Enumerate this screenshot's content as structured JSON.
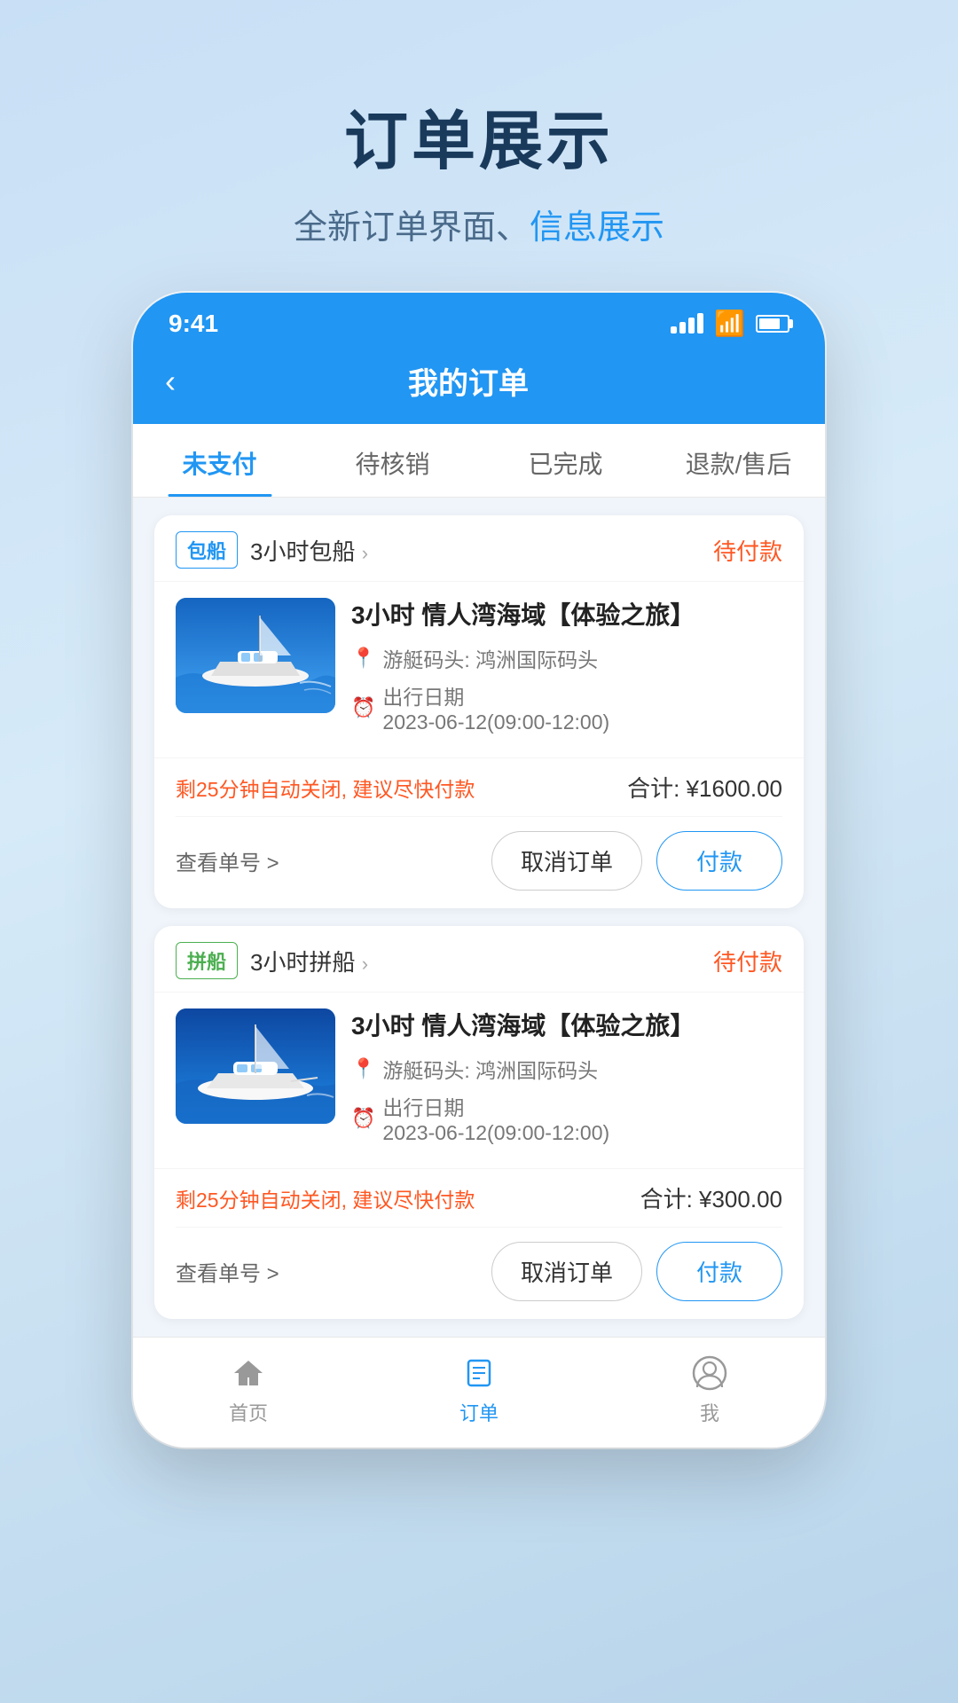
{
  "page": {
    "title": "订单展示",
    "subtitle_part1": "全新订单界面、",
    "subtitle_part2": "信息展示"
  },
  "statusBar": {
    "time": "9:41",
    "signal": "signal",
    "wifi": "wifi",
    "battery": "battery"
  },
  "navBar": {
    "title": "我的订单",
    "backLabel": "<"
  },
  "tabs": [
    {
      "label": "未支付",
      "active": true
    },
    {
      "label": "待核销",
      "active": false
    },
    {
      "label": "已完成",
      "active": false
    },
    {
      "label": "退款/售后",
      "active": false
    }
  ],
  "orders": [
    {
      "tag": "包船",
      "tagClass": "baochuan",
      "type": "3小时包船",
      "status": "待付款",
      "name": "3小时 情人湾海域【体验之旅】",
      "location": "游艇码头: 鸿洲国际码头",
      "dateLabel": "出行日期",
      "date": "2023-06-12(09:00-12:00)",
      "warning": "剩25分钟自动关闭, 建议尽快付款",
      "total": "合计: ¥1600.00",
      "viewOrder": "查看单号 >",
      "btnCancel": "取消订单",
      "btnPay": "付款"
    },
    {
      "tag": "拼船",
      "tagClass": "pinjian",
      "type": "3小时拼船",
      "status": "待付款",
      "name": "3小时 情人湾海域【体验之旅】",
      "location": "游艇码头: 鸿洲国际码头",
      "dateLabel": "出行日期",
      "date": "2023-06-12(09:00-12:00)",
      "warning": "剩25分钟自动关闭, 建议尽快付款",
      "total": "合计: ¥300.00",
      "viewOrder": "查看单号 >",
      "btnCancel": "取消订单",
      "btnPay": "付款"
    }
  ],
  "bottomNav": [
    {
      "label": "首页",
      "icon": "home",
      "active": false
    },
    {
      "label": "订单",
      "icon": "orders",
      "active": true
    },
    {
      "label": "我",
      "icon": "profile",
      "active": false
    }
  ]
}
